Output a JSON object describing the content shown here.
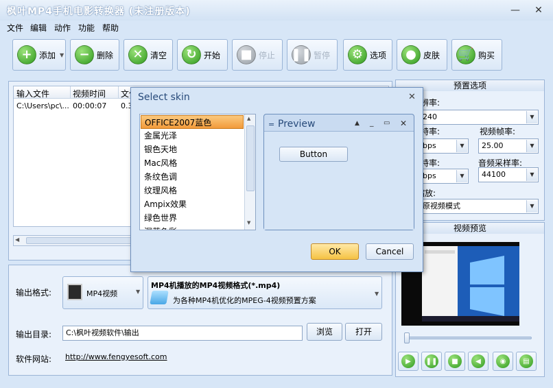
{
  "window": {
    "title": "枫叶MP4手机电影转换器  (未注册版本)",
    "minimize": "—",
    "close": "✕"
  },
  "menu": [
    "文件",
    "编辑",
    "动作",
    "功能",
    "帮助"
  ],
  "toolbar": {
    "add": "添加",
    "delete": "删除",
    "clear": "清空",
    "start": "开始",
    "stop": "停止",
    "pause": "暂停",
    "options": "选项",
    "skin": "皮肤",
    "buy": "购买"
  },
  "file_list": {
    "columns": [
      "输入文件",
      "视频时间",
      "文件"
    ],
    "rows": [
      {
        "file": "C:\\Users\\pc\\...",
        "duration": "00:00:07",
        "size": "0.3"
      }
    ]
  },
  "presets": {
    "title": "预置选项",
    "resolution_label": "分辨率:",
    "resolution_value": "240",
    "video_bitrate_label": "比特率:",
    "video_bitrate_value": "bps",
    "frame_rate_label": "视频帧率:",
    "frame_rate_value": "25.00",
    "audio_bitrate_label": "比特率:",
    "audio_bitrate_value": "bps",
    "sample_rate_label": "音频采样率:",
    "sample_rate_value": "44100",
    "zoom_label": "缩放:",
    "zoom_value": "原视频模式"
  },
  "preview": {
    "title": "视频预览",
    "progress": 0.0
  },
  "output": {
    "format_label": "输出格式:",
    "format_value": "MP4视频",
    "format_title": "MP4机播放的MP4视频格式(*.mp4)",
    "format_desc": "为各种MP4机优化的MPEG-4视频预置方案",
    "dir_label": "输出目录:",
    "dir_value": "C:\\枫叶视频软件\\输出",
    "browse": "浏览",
    "open": "打开",
    "site_label": "软件网站:",
    "site_url": "http://www.fengyesoft.com"
  },
  "dialog": {
    "title": "Select skin",
    "close": "✕",
    "skins": [
      "OFFICE2007蓝色",
      "金属光泽",
      "银色天地",
      "Mac风格",
      "条纹色调",
      "纹理风格",
      "Ampix效果",
      "绿色世界",
      "深蓝色彩"
    ],
    "selected_index": 0,
    "preview_title": "Preview",
    "preview_button": "Button",
    "ok": "OK",
    "cancel": "Cancel"
  },
  "colors": {
    "accent": "#f5a623",
    "titlebar": "#d2e2f4",
    "panel_border": "#9ab4d6",
    "selected_skin": "#f29a3a"
  }
}
